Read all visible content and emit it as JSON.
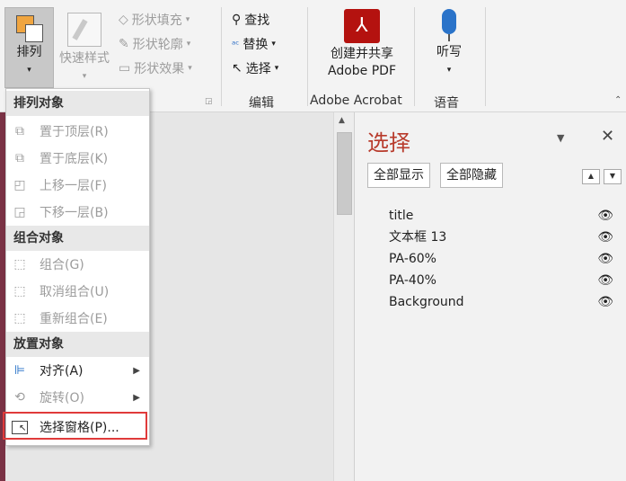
{
  "ribbon": {
    "arrange": {
      "label": "排列"
    },
    "quick_styles": {
      "label": "快速样式"
    },
    "shape_fill": "形状填充",
    "shape_outline": "形状轮廓",
    "shape_effects": "形状效果",
    "find": "查找",
    "replace": "替换",
    "select": "选择",
    "group_edit": "编辑",
    "adobe_btn": {
      "line1": "创建并共享",
      "line2": "Adobe PDF"
    },
    "group_adobe": "Adobe Acrobat",
    "dictate": {
      "label": "听写"
    },
    "group_voice": "语音"
  },
  "menu": {
    "head1": "排列对象",
    "items1": [
      {
        "label": "置于顶层(R)",
        "icon": "bring-to-front-icon"
      },
      {
        "label": "置于底层(K)",
        "icon": "send-to-back-icon"
      },
      {
        "label": "上移一层(F)",
        "icon": "bring-forward-icon"
      },
      {
        "label": "下移一层(B)",
        "icon": "send-backward-icon"
      }
    ],
    "head2": "组合对象",
    "items2": [
      {
        "label": "组合(G)",
        "icon": "group-icon"
      },
      {
        "label": "取消组合(U)",
        "icon": "ungroup-icon"
      },
      {
        "label": "重新组合(E)",
        "icon": "regroup-icon"
      }
    ],
    "head3": "放置对象",
    "align": "对齐(A)",
    "rotate": "旋转(O)",
    "selection_pane": "选择窗格(P)..."
  },
  "pane": {
    "title": "选择",
    "show_all": "全部显示",
    "hide_all": "全部隐藏",
    "items": [
      "title",
      "文本框 13",
      "PA-60%",
      "PA-40%",
      "Background"
    ]
  },
  "colors": {
    "accent": "#b83b2c",
    "highlight": "#e03a3a",
    "adobe": "#b4120f"
  }
}
